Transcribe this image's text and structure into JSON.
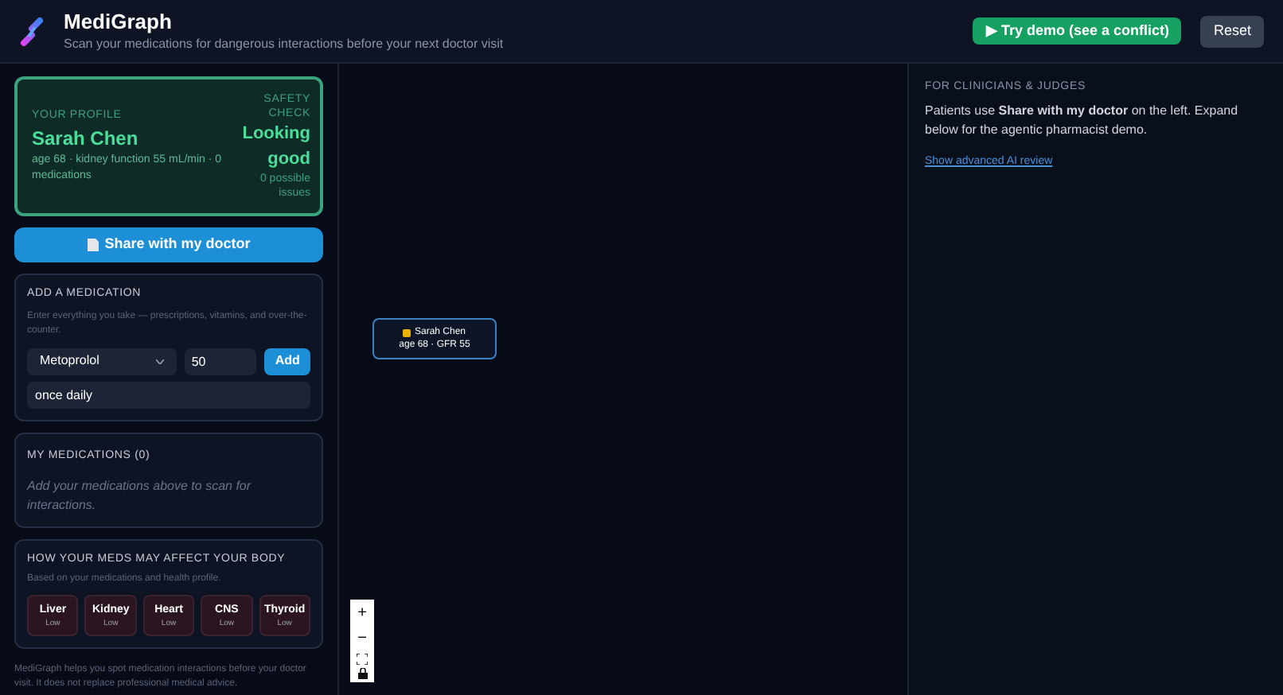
{
  "header": {
    "title": "MediGraph",
    "subtitle": "Scan your medications for dangerous interactions before your next doctor visit",
    "demo_button": "▶ Try demo (see a conflict)",
    "reset_button": "Reset"
  },
  "profile": {
    "label": "YOUR PROFILE",
    "name": "Sarah Chen",
    "details": "age 68 · kidney function 55 mL/min · 0 medications",
    "check_label": "SAFETY CHECK",
    "status": "Looking good",
    "issues": "0 possible issues"
  },
  "share_button": "Share with my doctor",
  "add_medication": {
    "title": "ADD A MEDICATION",
    "hint": "Enter everything you take — prescriptions, vitamins, and over-the-counter.",
    "drug": "Metoprolol",
    "dose": "50",
    "add_button": "Add",
    "frequency": "once daily"
  },
  "my_medications": {
    "title": "MY MEDICATIONS (0)",
    "empty": "Add your medications above to scan for interactions."
  },
  "body": {
    "title": "HOW YOUR MEDS MAY AFFECT YOUR BODY",
    "subtitle": "Based on your medications and health profile.",
    "organs": [
      {
        "name": "Liver",
        "risk": "Low"
      },
      {
        "name": "Kidney",
        "risk": "Low"
      },
      {
        "name": "Heart",
        "risk": "Low"
      },
      {
        "name": "CNS",
        "risk": "Low"
      },
      {
        "name": "Thyroid",
        "risk": "Low"
      }
    ]
  },
  "footer": "MediGraph helps you spot medication interactions before your doctor visit. It does not replace professional medical advice.",
  "graph": {
    "node": {
      "name": "Sarah Chen",
      "details": "age 68 · GFR 55"
    },
    "controls": [
      "+",
      "−"
    ]
  },
  "clinicians": {
    "label": "FOR CLINICIANS & JUDGES",
    "text": "Patients use **Share with my doctor** on the left. Expand below for the agentic pharmacist demo.",
    "link": "Show advanced AI review"
  }
}
